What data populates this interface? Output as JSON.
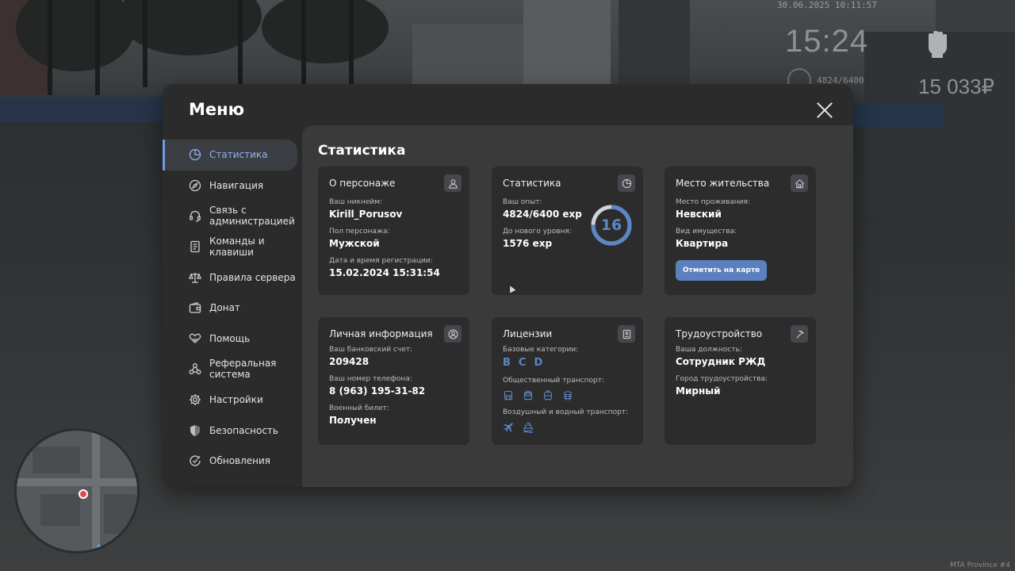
{
  "hud": {
    "datetime": "30.06.2025 10:11:57",
    "clock": "15:24",
    "exp": "4824/6400",
    "money": "15 033₽"
  },
  "watermark": "MTA Province #4",
  "menu": {
    "title": "Меню",
    "sidebar": [
      {
        "label": "Статистика",
        "icon": "pie-chart-icon",
        "active": true
      },
      {
        "label": "Навигация",
        "icon": "compass-icon"
      },
      {
        "label": "Связь с\nадминистрацией",
        "icon": "headset-icon"
      },
      {
        "label": "Команды и\nклавиши",
        "icon": "document-icon"
      },
      {
        "label": "Правила сервера",
        "icon": "scales-icon"
      },
      {
        "label": "Донат",
        "icon": "wallet-icon"
      },
      {
        "label": "Помощь",
        "icon": "heart-hands-icon"
      },
      {
        "label": "Реферальная\nсистема",
        "icon": "network-icon"
      },
      {
        "label": "Настройки",
        "icon": "gear-icon"
      },
      {
        "label": "Безопасность",
        "icon": "shield-icon"
      },
      {
        "label": "Обновления",
        "icon": "check-circle-icon"
      }
    ]
  },
  "stats": {
    "title": "Статистика",
    "character": {
      "title": "О персонаже",
      "nickname_label": "Ваш никнейм:",
      "nickname": "Kirill_Porusov",
      "gender_label": "Пол персонажа:",
      "gender": "Мужской",
      "reg_label": "Дата и время регистрации:",
      "reg_date": "15.02.2024 15:31:54"
    },
    "statistics": {
      "title": "Статистика",
      "exp_label": "Ваш опыт:",
      "exp": "4824/6400 exp",
      "next_label": "До нового уровня:",
      "next": "1576 exp",
      "level": "16",
      "progress": 0.7537
    },
    "residence": {
      "title": "Место жительства",
      "place_label": "Место проживания:",
      "place": "Невский",
      "property_label": "Вид имущества:",
      "property": "Квартира",
      "map_button": "Отметить на карте"
    },
    "personal": {
      "title": "Личная информация",
      "bank_label": "Ваш банковский счет:",
      "bank": "209428",
      "phone_label": "Ваш номер телефона:",
      "phone": "8 (963) 195-31-82",
      "military_label": "Военный билет:",
      "military": "Получен"
    },
    "licenses": {
      "title": "Лицензии",
      "base_label": "Базовые категории:",
      "categories": [
        "B",
        "C",
        "D"
      ],
      "public_label": "Общественный транспорт:",
      "air_label": "Воздушный и водный транспорт:"
    },
    "employment": {
      "title": "Трудоустройство",
      "position_label": "Ваша должность:",
      "position": "Сотрудник РЖД",
      "city_label": "Город трудоустройства:",
      "city": "Мирный"
    }
  }
}
